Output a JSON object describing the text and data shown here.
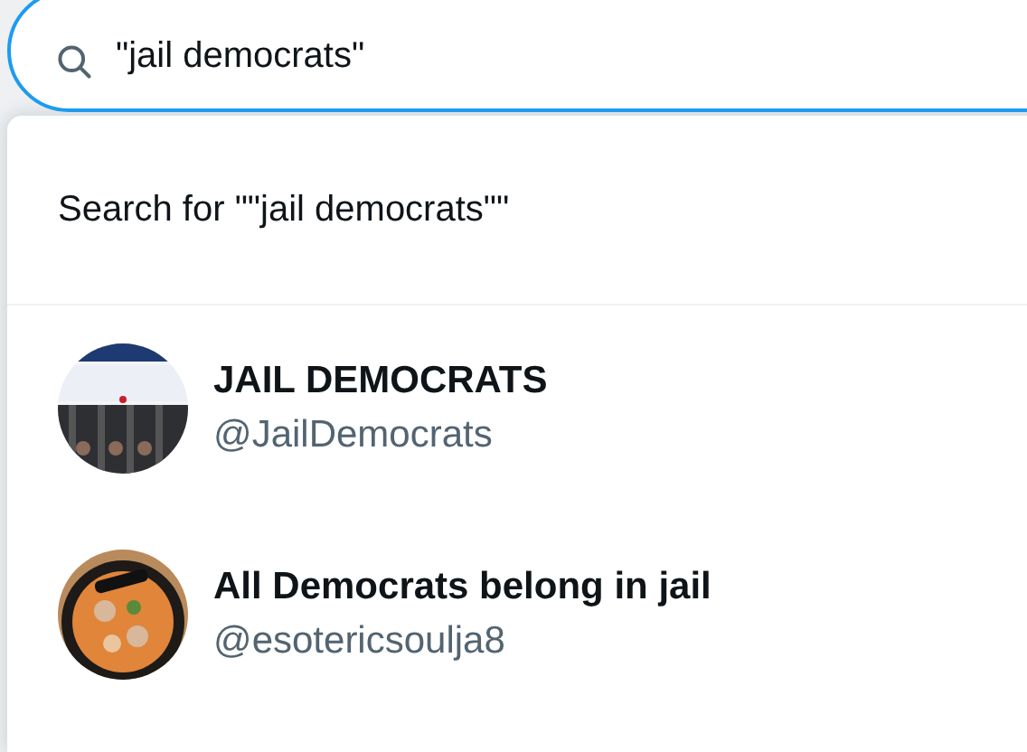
{
  "search": {
    "value": "\"jail democrats\""
  },
  "suggestion": {
    "label": "Search for \"\"jail democrats\"\""
  },
  "accounts": [
    {
      "name": "JAIL DEMOCRATS",
      "handle": "@JailDemocrats"
    },
    {
      "name": "All Democrats belong in jail",
      "handle": "@esotericsoulja8"
    }
  ]
}
